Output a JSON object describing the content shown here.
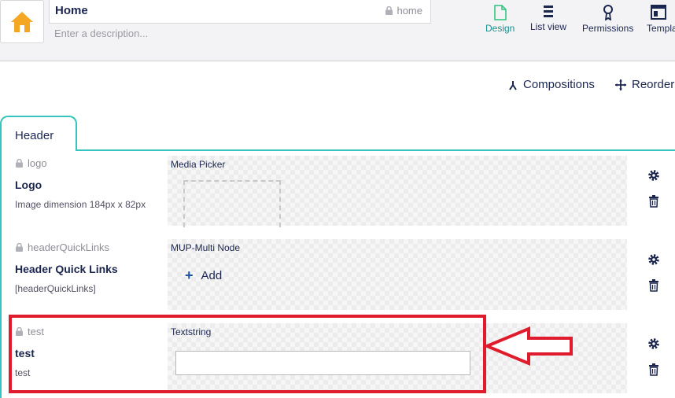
{
  "header": {
    "home_icon": "home-icon",
    "name_value": "Home",
    "alias_value": "home",
    "description_placeholder": "Enter a description..."
  },
  "apps": [
    {
      "label": "Design",
      "icon": "design-icon",
      "active": true
    },
    {
      "label": "List view",
      "icon": "list-view-icon",
      "active": false
    },
    {
      "label": "Permissions",
      "icon": "permissions-icon",
      "active": false
    },
    {
      "label": "Templa",
      "icon": "templates-icon",
      "active": false
    }
  ],
  "actions": {
    "compositions_label": "Compositions",
    "reorder_label": "Reorder"
  },
  "tab": {
    "label": "Header"
  },
  "properties": [
    {
      "alias": "logo",
      "label": "Logo",
      "description": "Image dimension 184px x 82px",
      "editor": "Media Picker"
    },
    {
      "alias": "headerQuickLinks",
      "label": "Header Quick Links",
      "description": "[headerQuickLinks]",
      "editor": "MUP-Multi Node",
      "add_label": "Add"
    },
    {
      "alias": "test",
      "label": "test",
      "description": "test",
      "editor": "Textstring"
    }
  ],
  "colors": {
    "accent": "#35c4c0",
    "highlight": "#e01b2b",
    "home_orange": "#f5a623"
  }
}
